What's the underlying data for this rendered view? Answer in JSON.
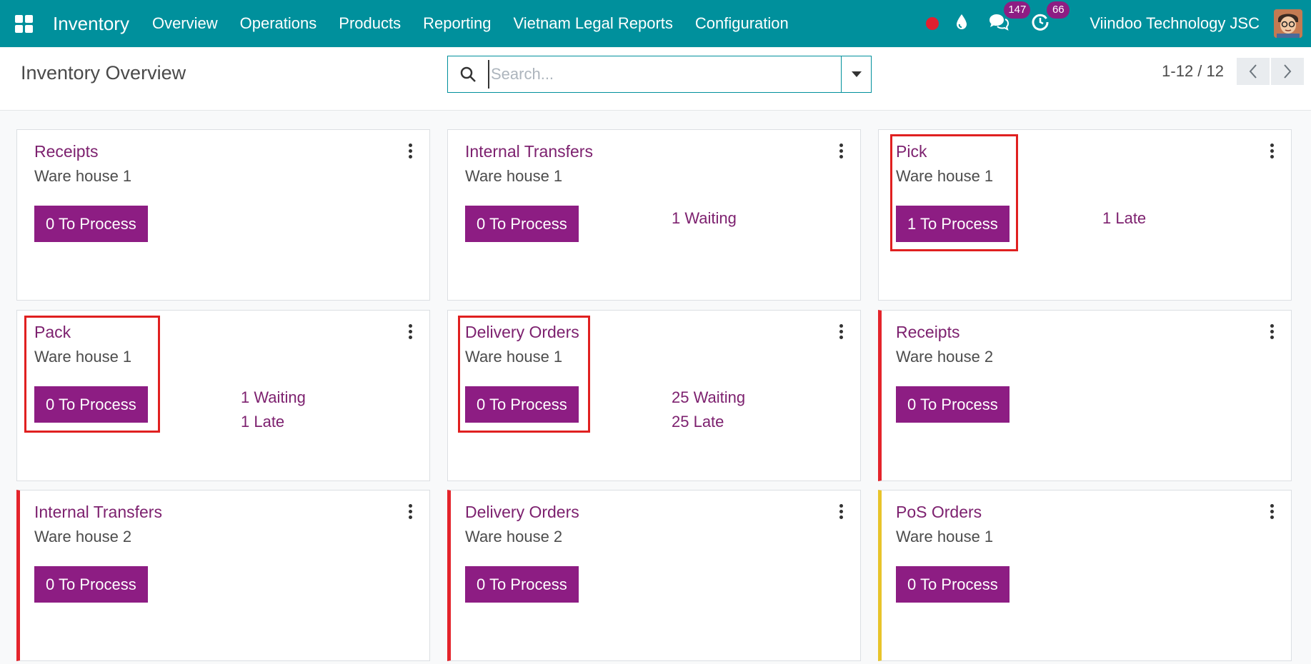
{
  "navbar": {
    "brand": "Inventory",
    "menu": [
      "Overview",
      "Operations",
      "Products",
      "Reporting",
      "Vietnam Legal Reports",
      "Configuration"
    ],
    "messages_count": "147",
    "activities_count": "66",
    "company": "Viindoo Technology JSC",
    "colors": {
      "bar": "#00909c",
      "recording": "#e0202f",
      "badge": "#8d1d83"
    }
  },
  "control_panel": {
    "title": "Inventory Overview",
    "search_placeholder": "Search...",
    "pager_value": "1-12 / 12"
  },
  "cards": [
    {
      "title": "Receipts",
      "warehouse": "Ware house 1",
      "button": "0 To Process",
      "stats": []
    },
    {
      "title": "Internal Transfers",
      "warehouse": "Ware house 1",
      "button": "0 To Process",
      "stats": [
        "1 Waiting"
      ]
    },
    {
      "title": "Pick",
      "warehouse": "Ware house 1",
      "button": "1 To Process",
      "stats": [
        "1 Late"
      ]
    },
    {
      "title": "Pack",
      "warehouse": "Ware house 1",
      "button": "0 To Process",
      "stats": [
        "1 Waiting",
        "1 Late"
      ]
    },
    {
      "title": "Delivery Orders",
      "warehouse": "Ware house 1",
      "button": "0 To Process",
      "stats": [
        "25 Waiting",
        "25 Late"
      ]
    },
    {
      "title": "Receipts",
      "warehouse": "Ware house 2",
      "button": "0 To Process",
      "stats": [],
      "color_bar": "#e4242b"
    },
    {
      "title": "Internal Transfers",
      "warehouse": "Ware house 2",
      "button": "0 To Process",
      "stats": [],
      "color_bar": "#e4242b"
    },
    {
      "title": "Delivery Orders",
      "warehouse": "Ware house 2",
      "button": "0 To Process",
      "stats": [],
      "color_bar": "#e4242b"
    },
    {
      "title": "PoS Orders",
      "warehouse": "Ware house 1",
      "button": "0 To Process",
      "stats": [],
      "color_bar": "#e8c42a"
    }
  ],
  "colors": {
    "accent": "#7d216f",
    "button": "#8d1d83",
    "highlight": "#e02020"
  }
}
